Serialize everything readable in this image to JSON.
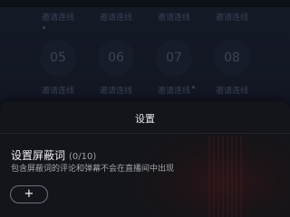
{
  "background": {
    "top_labels": [
      "邀请连线",
      "邀请连线",
      "邀请连线",
      "邀请连线"
    ],
    "seats": [
      "05",
      "06",
      "07",
      "08"
    ],
    "bottom_labels": [
      "邀请连线",
      "邀请连线",
      "邀请连线",
      "邀请连线"
    ]
  },
  "sheet": {
    "title": "设置",
    "setting": {
      "title": "设置屏蔽词",
      "count": "(0/10)",
      "description": "包含屏蔽词的评论和弹幕不会在直播间中出现"
    },
    "add_button": {
      "icon": "plus-icon",
      "label": "+"
    }
  },
  "colors": {
    "sheet_background": "#14151a",
    "page_background": "#131725",
    "text_primary": "#f0f0f3",
    "text_secondary": "#a2a5ae"
  }
}
